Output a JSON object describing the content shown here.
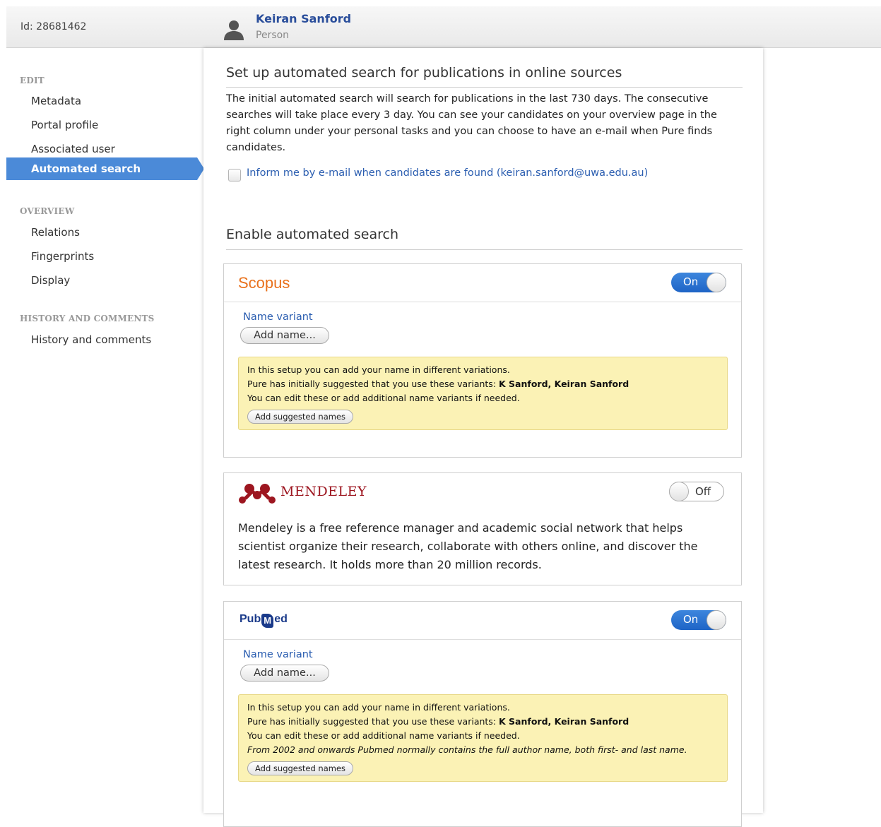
{
  "header": {
    "id_text": "Id: 28681462",
    "name": "Keiran Sanford",
    "type": "Person"
  },
  "sidebar": {
    "sections": [
      {
        "heading": "EDIT",
        "items": [
          "Metadata",
          "Portal profile",
          "Associated user",
          "Automated search"
        ]
      },
      {
        "heading": "OVERVIEW",
        "items": [
          "Relations",
          "Fingerprints",
          "Display"
        ]
      },
      {
        "heading": "HISTORY AND COMMENTS",
        "items": [
          "History and comments"
        ]
      }
    ],
    "active_item": "Automated search"
  },
  "main": {
    "setup_title": "Set up automated search for publications in online sources",
    "intro": "The initial automated search will search for publications in the last 730 days. The consecutive searches will take place every 3 day. You can see your candidates on your overview page in the right column under your personal tasks and you can choose to have an e-mail when Pure finds candidates.",
    "email_checkbox_label": "Inform me by e-mail when candidates are found (keiran.sanford@uwa.edu.au)",
    "email_checkbox_checked": false,
    "enable_title": "Enable automated search",
    "sources": {
      "scopus": {
        "logo_text": "Scopus",
        "toggle": "On",
        "name_variant_label": "Name variant",
        "add_name_button": "Add name...",
        "note_line1": "In this setup you can add your name in different variations.",
        "note_line2_prefix": "Pure has initially suggested that you use these variants: ",
        "note_line2_variants": "K Sanford, Keiran Sanford",
        "note_line3": "You can edit these or add additional name variants if needed.",
        "add_suggested_button": "Add suggested names"
      },
      "mendeley": {
        "logo_text": "MENDELEY",
        "toggle": "Off",
        "description": "Mendeley is a free reference manager and academic social network that helps scientist organize their research, collaborate with others online, and discover the latest research. It holds more than 20 million records."
      },
      "pubmed": {
        "logo_text_pre": "Pub",
        "logo_text_m": "M",
        "logo_text_post": "ed",
        "toggle": "On",
        "name_variant_label": "Name variant",
        "add_name_button": "Add name...",
        "note_line1": "In this setup you can add your name in different variations.",
        "note_line2_prefix": "Pure has initially suggested that you use these variants: ",
        "note_line2_variants": "K Sanford, Keiran Sanford",
        "note_line3": "You can edit these or add additional name variants if needed.",
        "note_line4": "From 2002 and onwards Pubmed normally contains the full author name, both first- and last name.",
        "add_suggested_button": "Add suggested names"
      }
    }
  },
  "colors": {
    "accent": "#4b8ad8",
    "link": "#2a5db0",
    "scopus": "#e9711c",
    "mendeley": "#9d1620",
    "note_bg": "#fbf2b5"
  }
}
